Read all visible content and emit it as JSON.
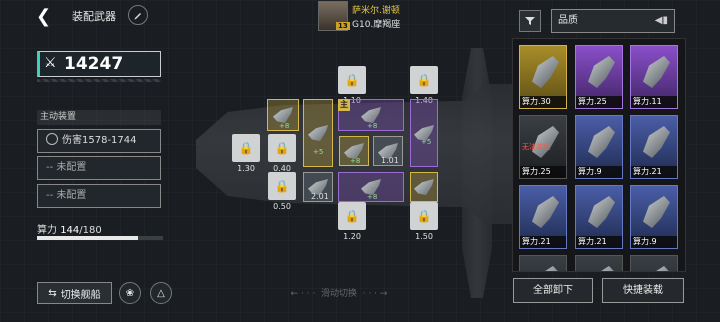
{
  "header": {
    "back_icon": "back-chevron-icon",
    "title": "装配武器",
    "edit_icon": "pencil-icon"
  },
  "captain": {
    "name": "萨米尔.谢顿",
    "ship": "G10.摩羯座",
    "level": "13"
  },
  "filter": {
    "sort_label": "品质",
    "filter_icon": "filter-icon",
    "sort_icon": "sort-order-icon"
  },
  "left_panel": {
    "total_power": "14247",
    "section_label": "主动装置",
    "slots": [
      "伤害1578-1744",
      "-- 未配置",
      "-- 未配置"
    ],
    "capacity_label": "算力",
    "capacity_current": "144",
    "capacity_max": "/180",
    "capacity_fraction": 0.8
  },
  "ship_slots": {
    "locked_values": [
      "1.10",
      "1.40",
      "1.30",
      "0.40",
      "0.50",
      "1.20",
      "1.50"
    ],
    "weapon_levels": [
      "1.01",
      "2.01"
    ],
    "plus_labels": [
      "+8",
      "+5",
      "+8",
      "+5",
      "+8",
      "+8"
    ],
    "main_tag": "主"
  },
  "inventory": {
    "cards": [
      {
        "power": "算力.30",
        "rarity": "gold"
      },
      {
        "power": "算力.25",
        "rarity": "purple"
      },
      {
        "power": "算力.11",
        "rarity": "purple"
      },
      {
        "power": "算力.25",
        "rarity": "dark",
        "warning": "无法装配"
      },
      {
        "power": "算力.9",
        "rarity": "blue"
      },
      {
        "power": "算力.21",
        "rarity": "blue"
      },
      {
        "power": "算力.21",
        "rarity": "blue"
      },
      {
        "power": "算力.21",
        "rarity": "blue"
      },
      {
        "power": "算力.9",
        "rarity": "blue"
      }
    ]
  },
  "bottom": {
    "switch_ship": "切换舰船",
    "swipe_hint": "滑动切换",
    "unload_all": "全部卸下",
    "quick_equip": "快捷装载"
  }
}
